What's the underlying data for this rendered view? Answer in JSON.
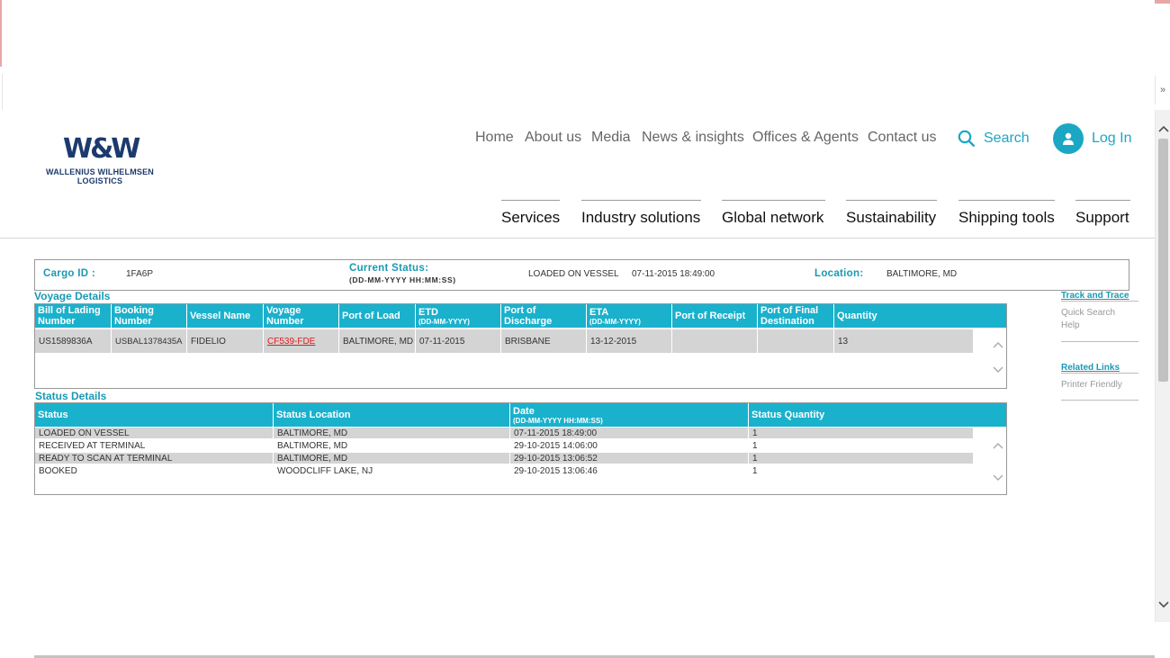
{
  "window": {
    "expand_glyph": "»"
  },
  "brand": {
    "mark": "W&W",
    "name_line1": "WALLENIUS WILHELMSEN",
    "name_line2": "LOGISTICS",
    "color": "#1d3a6e"
  },
  "top_nav": [
    "Home",
    "About us",
    "Media",
    "News & insights",
    "Offices & Agents",
    "Contact us"
  ],
  "search": {
    "label": "Search",
    "icon": "search-icon"
  },
  "login": {
    "label": "Log In",
    "icon": "user-icon"
  },
  "main_nav": [
    "Services",
    "Industry solutions",
    "Global network",
    "Sustainability",
    "Shipping tools",
    "Support"
  ],
  "accent_color": "#1ab1cc",
  "cargo": {
    "id_label": "Cargo ID :",
    "id_value": "1FA6P",
    "status_label": "Current Status:",
    "status_format": "(DD-MM-YYYY HH:MM:SS)",
    "status_value": "LOADED ON VESSEL",
    "status_time": "07-11-2015 18:49:00",
    "location_label": "Location:",
    "location_value": "BALTIMORE, MD"
  },
  "voyage": {
    "title": "Voyage  Details",
    "columns": [
      {
        "label": "Bill of Lading Number",
        "sub": ""
      },
      {
        "label": "Booking Number",
        "sub": ""
      },
      {
        "label": "Vessel  Name",
        "sub": ""
      },
      {
        "label": "Voyage Number",
        "sub": ""
      },
      {
        "label": "Port of Load",
        "sub": ""
      },
      {
        "label": "ETD",
        "sub": "(DD-MM-YYYY)"
      },
      {
        "label": "Port of Discharge",
        "sub": ""
      },
      {
        "label": "ETA",
        "sub": "(DD-MM-YYYY)"
      },
      {
        "label": "Port of  Receipt",
        "sub": ""
      },
      {
        "label": "Port of Final Destination",
        "sub": ""
      },
      {
        "label": "Quantity",
        "sub": ""
      }
    ],
    "rows": [
      [
        "US1589836A",
        "USBAL1378435A",
        "FIDELIO",
        "CF539-FDE",
        "BALTIMORE, MD",
        "07-11-2015",
        "BRISBANE",
        "13-12-2015",
        "",
        "",
        "13"
      ]
    ]
  },
  "status": {
    "title": "Status Details",
    "columns": [
      {
        "label": "Status",
        "sub": ""
      },
      {
        "label": "Status Location",
        "sub": ""
      },
      {
        "label": "Date",
        "sub": "(DD-MM-YYYY HH:MM:SS)"
      },
      {
        "label": "Status Quantity",
        "sub": ""
      }
    ],
    "rows": [
      [
        "LOADED ON VESSEL",
        "BALTIMORE, MD",
        "07-11-2015 18:49:00",
        "1"
      ],
      [
        "RECEIVED AT TERMINAL",
        "BALTIMORE, MD",
        "29-10-2015 14:06:00",
        "1"
      ],
      [
        "READY TO SCAN AT TERMINAL",
        "BALTIMORE, MD",
        "29-10-2015 13:06:52",
        "1"
      ],
      [
        "BOOKED",
        "WOODCLIFF LAKE, NJ",
        "29-10-2015 13:06:46",
        "1"
      ]
    ]
  },
  "sidebar": {
    "track_title": "Track and Trace",
    "track_items": [
      "Quick Search",
      "Help"
    ],
    "related_title": "Related Links",
    "related_items": [
      "Printer Friendly"
    ]
  }
}
